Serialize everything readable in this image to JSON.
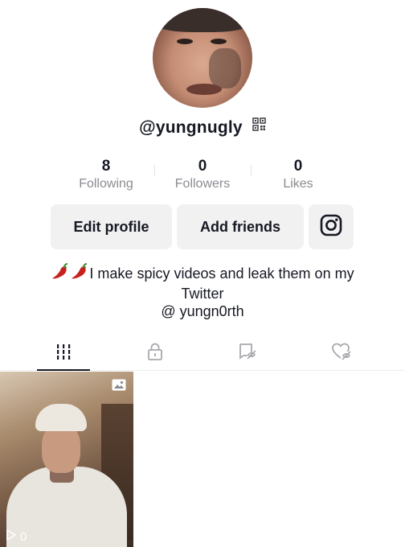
{
  "profile": {
    "username": "@yungnugly"
  },
  "stats": [
    {
      "value": "8",
      "label": "Following"
    },
    {
      "value": "0",
      "label": "Followers"
    },
    {
      "value": "0",
      "label": "Likes"
    }
  ],
  "actions": {
    "edit_profile": "Edit profile",
    "add_friends": "Add friends",
    "instagram_icon": "instagram-icon"
  },
  "bio": {
    "line1": "I make spicy videos and leak them on my",
    "line2": "Twitter",
    "line3": "@ yungn0rth",
    "emoji": "hot-pepper"
  },
  "tabs": [
    {
      "icon": "videos-grid-icon",
      "active": true
    },
    {
      "icon": "private-lock-icon",
      "active": false
    },
    {
      "icon": "tagged-icon",
      "active": false
    },
    {
      "icon": "liked-hidden-icon",
      "active": false
    }
  ],
  "videos": [
    {
      "type": "photo",
      "views": "0"
    }
  ],
  "colors": {
    "text": "#161823",
    "secondary": "#8a8b91",
    "button_bg": "#f1f1f2",
    "pepper": "#c8201e"
  }
}
